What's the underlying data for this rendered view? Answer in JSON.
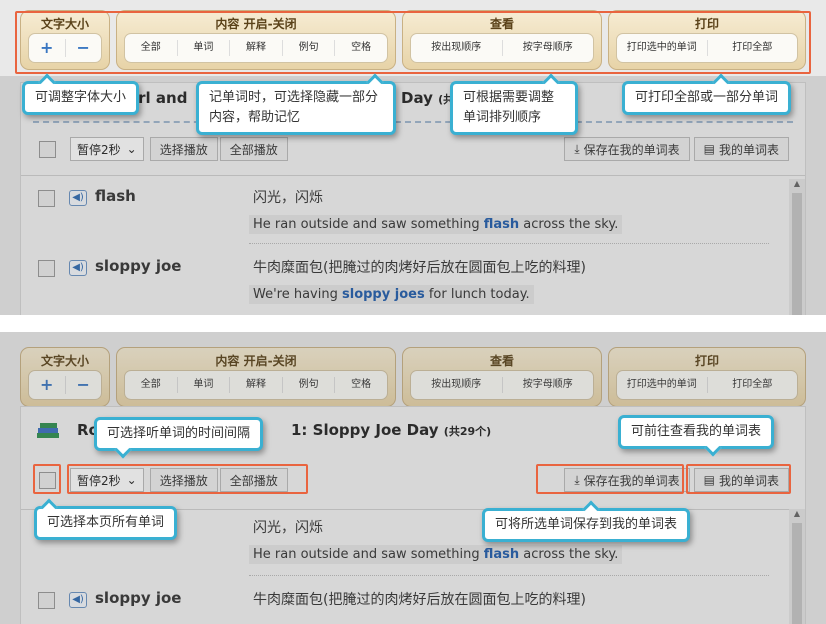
{
  "toolbar": {
    "font_size": {
      "title": "文字大小",
      "plus": "+",
      "minus": "−"
    },
    "content_toggle": {
      "title": "内容 开启-关闭",
      "buttons": [
        "全部",
        "单词",
        "解释",
        "例句",
        "空格"
      ]
    },
    "view": {
      "title": "查看",
      "buttons": [
        "按出现顺序",
        "按字母顺序"
      ]
    },
    "print": {
      "title": "打印",
      "buttons": [
        "打印选中的单词",
        "打印全部"
      ]
    }
  },
  "tips_top": {
    "font_size": "可调整字体大小",
    "content": "记单词时，可选择隐藏一部分内容，帮助记忆",
    "view": "可根据需要调整单词排列顺序",
    "print": "可打印全部或一部分单词"
  },
  "tips_bottom": {
    "interval": "可选择听单词的时间间隔",
    "my_list": "可前往查看我的单词表",
    "select_all": "可选择本页所有单词",
    "save": "可将所选单词保存到我的单词表"
  },
  "list": {
    "title_partial_top": "irl and",
    "title_day_top": "Day",
    "title_count_top": "(共",
    "title_partial_bottom": "Ro",
    "title_lesson_bottom": "1: Sloppy Joe Day",
    "title_count_bottom": "(共29个)",
    "pause_select": "暂停2秒",
    "play_selected": "选择播放",
    "play_all": "全部播放",
    "save_to_list": "保存在我的单词表",
    "my_list": "我的单词表"
  },
  "words": [
    {
      "word": "flash",
      "definition": "闪光，闪烁",
      "example_before": "He ran outside and saw something ",
      "example_key": "flash",
      "example_after": " across the sky."
    },
    {
      "word": "sloppy joe",
      "definition": "牛肉糜面包(把腌过的肉烤好后放在圆面包上吃的料理)",
      "example_before": "We're having ",
      "example_key": "sloppy joes",
      "example_after": " for lunch today."
    }
  ],
  "colors": {
    "highlight": "#e9643f",
    "tip_border": "#3ab0d2",
    "keyword": "#1f5cad"
  }
}
